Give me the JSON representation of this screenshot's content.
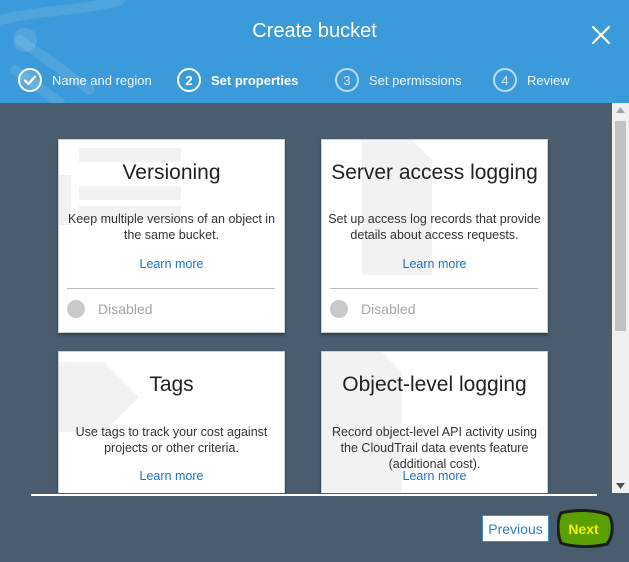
{
  "header": {
    "title": "Create bucket",
    "steps": [
      {
        "number": "1",
        "label": "Name and region",
        "state": "completed"
      },
      {
        "number": "2",
        "label": "Set properties",
        "state": "active"
      },
      {
        "number": "3",
        "label": "Set permissions",
        "state": "pending"
      },
      {
        "number": "4",
        "label": "Review",
        "state": "pending"
      }
    ]
  },
  "cards": [
    {
      "title": "Versioning",
      "description": "Keep multiple versions of an object in the same bucket.",
      "link": "Learn more",
      "status": "Disabled"
    },
    {
      "title": "Server access logging",
      "description": "Set up access log records that provide details about access requests.",
      "link": "Learn more",
      "status": "Disabled"
    },
    {
      "title": "Tags",
      "description": "Use tags to track your cost against projects or other criteria.",
      "link": "Learn more"
    },
    {
      "title": "Object-level logging",
      "description": "Record object-level API activity using the CloudTrail data events feature (additional cost).",
      "link": "Learn more"
    }
  ],
  "footer": {
    "previous_label": "Previous",
    "next_label": "Next"
  },
  "colors": {
    "header_bg": "#3b9ad9",
    "content_bg": "#4a5d6e",
    "link": "#1a73c9",
    "next_button": "#f4c430",
    "annotation_highlight": "#5aa000"
  }
}
